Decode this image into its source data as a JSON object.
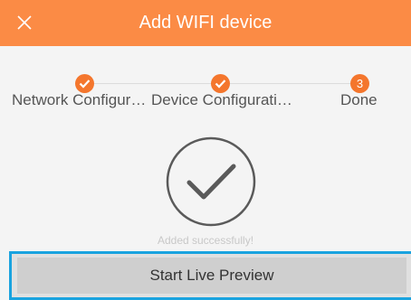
{
  "header": {
    "title": "Add WIFI device",
    "close_icon": "close-icon",
    "background": "#fb8b45"
  },
  "steps": [
    {
      "label": "Network Configur…",
      "state": "done",
      "marker": "check-icon"
    },
    {
      "label": "Device Configurati…",
      "state": "done",
      "marker": "check-icon"
    },
    {
      "label": "Done",
      "state": "current",
      "number": "3"
    }
  ],
  "success": {
    "icon": "check-circle-icon",
    "message": "Added successfully!"
  },
  "actions": {
    "start_live_preview": "Start Live Preview",
    "focus_color": "#1aa3df"
  }
}
